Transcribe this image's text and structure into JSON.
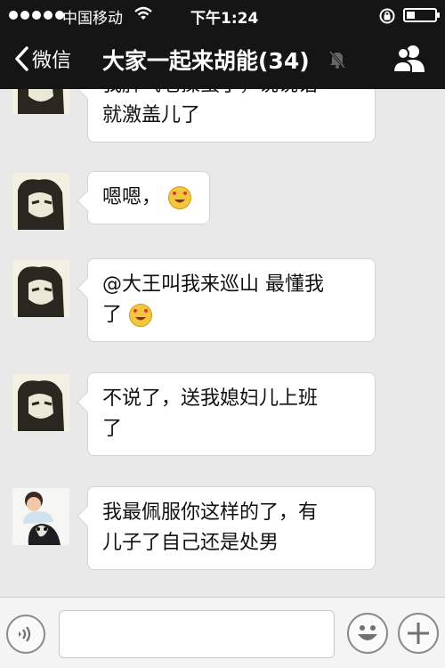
{
  "status_bar": {
    "signal_dots": 5,
    "carrier": "中国移动",
    "time": "下午1:24",
    "wifi_icon": "wifi-icon",
    "lock_icon": "orientation-lock-icon",
    "battery_level": 0.3
  },
  "nav": {
    "back_label": "微信",
    "title": "大家一起来胡能(34)",
    "mute_icon": "muted-bell-icon",
    "members_icon": "group-members-icon"
  },
  "messages": [
    {
      "avatar": "user-avatar-face",
      "lines": [
        "我脾气老操蛋了，说说话",
        "就激盖儿了"
      ]
    },
    {
      "avatar": "user-avatar-face",
      "lines": [
        "嗯嗯，"
      ],
      "emoji": "heart-eyes-emoji"
    },
    {
      "avatar": "user-avatar-face",
      "lines": [
        "@大王叫我来巡山 最懂我",
        "了"
      ],
      "emoji": "heart-eyes-emoji"
    },
    {
      "avatar": "user-avatar-face",
      "lines": [
        "不说了，送我媳妇儿上班",
        "了"
      ]
    },
    {
      "avatar": "child-with-dog-avatar",
      "lines": [
        "我最佩服你这样的了，有",
        "儿子了自己还是处男"
      ]
    }
  ],
  "input_bar": {
    "voice_icon": "voice-input-icon",
    "text_value": "",
    "emoji_icon": "smiley-icon",
    "plus_icon": "plus-icon"
  },
  "colors": {
    "top_bar": "#151515",
    "chat_bg": "#e9e9e9",
    "bubble": "#ffffff",
    "emoji_face": "#f4c63d"
  }
}
